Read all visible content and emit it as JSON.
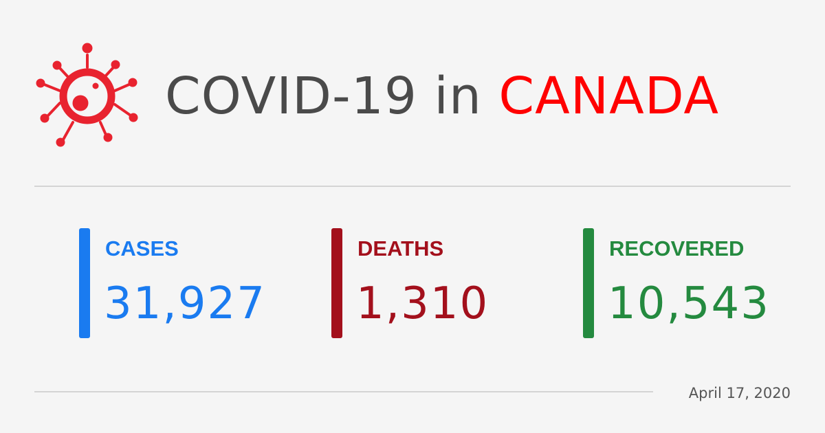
{
  "header": {
    "title_main": "COVID-19 in ",
    "title_country": "CANADA",
    "icon": "virus-icon"
  },
  "stats": [
    {
      "label": "CASES",
      "value": "31,927",
      "color": "#1a7bf0"
    },
    {
      "label": "DEATHS",
      "value": "1,310",
      "color": "#a3101c"
    },
    {
      "label": "RECOVERED",
      "value": "10,543",
      "color": "#248a3f"
    }
  ],
  "footer": {
    "date": "April 17, 2020"
  },
  "colors": {
    "background": "#f5f5f5",
    "title_main": "#4a4a4a",
    "title_country": "#ff0000",
    "virus": "#e8232f",
    "divider": "#d4d4d4"
  }
}
